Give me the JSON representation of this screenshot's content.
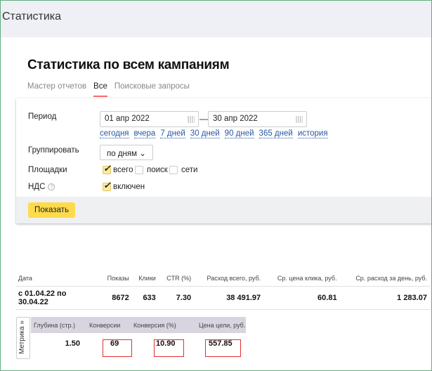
{
  "header": {
    "title": "Статистика"
  },
  "page": {
    "title": "Статистика по всем кампаниям"
  },
  "tabs": [
    {
      "label": "Мастер отчетов"
    },
    {
      "label": "Все",
      "active": true
    },
    {
      "label": "Поисковые запросы"
    }
  ],
  "form": {
    "period_label": "Период",
    "date_from": "01 апр 2022",
    "date_sep": "—",
    "date_to": "30 апр 2022",
    "quick_links": [
      "сегодня",
      "вчера",
      "7 дней",
      "30 дней",
      "90 дней",
      "365 дней",
      "история"
    ],
    "group_label": "Группировать",
    "group_value": "по дням",
    "platforms_label": "Площадки",
    "platforms": [
      {
        "label": "всего",
        "checked": true
      },
      {
        "label": "поиск",
        "checked": false
      },
      {
        "label": "сети",
        "checked": false
      }
    ],
    "vat_label": "НДС",
    "vat_option": {
      "label": "включен",
      "checked": true
    },
    "submit": "Показать"
  },
  "table": {
    "columns": [
      "Дата",
      "Показы",
      "Клики",
      "CTR (%)",
      "Расход всего, руб.",
      "Ср. цена клика, руб.",
      "Ср. расход за день, руб."
    ],
    "row": [
      "с 01.04.22 по 30.04.22",
      "8672",
      "633",
      "7.30",
      "38 491.97",
      "60.81",
      "1 283.07"
    ]
  },
  "metrika": {
    "tab_label": "Метрика »",
    "columns": [
      "Глубина (стр.)",
      "Конверсии",
      "Конверсия (%)",
      "Цена цели, руб."
    ],
    "values": [
      "1.50",
      "69",
      "10.90",
      "557.85"
    ]
  },
  "colors": {
    "accent_button": "#fedb4d",
    "link": "#2956a4",
    "highlight_box": "#e03030",
    "active_tab_underline": "#ff6666"
  }
}
